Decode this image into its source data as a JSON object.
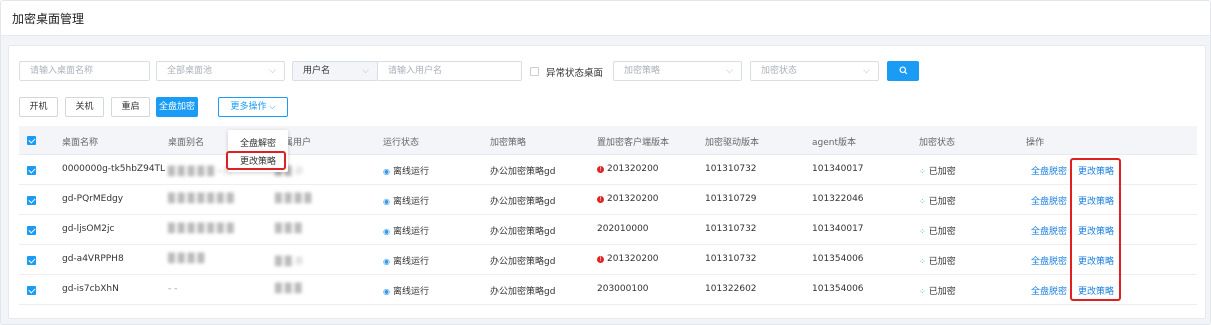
{
  "page": {
    "title": "加密桌面管理"
  },
  "filters": {
    "desktop_name_placeholder": "请输入桌面名称",
    "desktop_pool_placeholder": "全部桌面池",
    "user_type_selected": "用户名",
    "username_placeholder": "请输入用户名",
    "abnormal_label": "异常状态桌面",
    "policy_placeholder": "加密策略",
    "status_placeholder": "加密状态",
    "search_icon": "search-icon"
  },
  "toolbar": {
    "power_on": "开机",
    "power_off": "关机",
    "restart": "重启",
    "full_encrypt": "全盘加密",
    "more_actions": "更多操作"
  },
  "dropdown": {
    "full_decrypt": "全盘解密",
    "change_policy": "更改策略"
  },
  "table": {
    "headers": [
      "桌面名称",
      "桌面别名",
      "所属用户",
      "运行状态",
      "加密策略",
      "置加密客户端版本",
      "加密驱动版本",
      "agent版本",
      "加密状态",
      "操作"
    ],
    "rows": [
      {
        "name": "0000000g-tk5hbZ94TL",
        "alias": "█ █ █ █ █ ─力",
        "user": "█ █ 示",
        "run": "离线运行",
        "policy": "办公加密策略gd",
        "client": "201320200",
        "client_warn": true,
        "driver": "101310732",
        "agent": "101340017",
        "enc": "已加密",
        "op1": "全盘脱密",
        "op2": "更改策略"
      },
      {
        "name": "gd-PQrMEdgy",
        "alias": "█ █ █ █ █ █ █",
        "user": "█ █ █ █",
        "run": "离线运行",
        "policy": "办公加密策略gd",
        "client": "201320200",
        "client_warn": true,
        "driver": "101310729",
        "agent": "101322046",
        "enc": "已加密",
        "op1": "全盘脱密",
        "op2": "更改策略"
      },
      {
        "name": "gd-ljsOM2jc",
        "alias": "█ █ █ █ █ █ █",
        "user": "█ █ █",
        "run": "离线运行",
        "policy": "办公加密策略gd",
        "client": "202010000",
        "client_warn": false,
        "driver": "101310732",
        "agent": "101340017",
        "enc": "已加密",
        "op1": "全盘脱密",
        "op2": "更改策略"
      },
      {
        "name": "gd-a4VRPPH8",
        "alias": "█ █ █ █",
        "user": "█ █ 杀",
        "run": "离线运行",
        "policy": "办公加密策略gd",
        "client": "201320200",
        "client_warn": true,
        "driver": "101310732",
        "agent": "101354006",
        "enc": "已加密",
        "op1": "全盘脱密",
        "op2": "更改策略"
      },
      {
        "name": "gd-is7cbXhN",
        "alias": "- -",
        "user": "█ █ █",
        "run": "离线运行",
        "policy": "办公加密策略gd",
        "client": "203000100",
        "client_warn": false,
        "driver": "101322602",
        "agent": "101354006",
        "enc": "已加密",
        "op1": "全盘脱密",
        "op2": "更改策略"
      }
    ]
  },
  "colors": {
    "primary": "#1a9cf4",
    "highlight": "#e02020",
    "status_green": "#2bb673",
    "warn_red": "#e02424"
  }
}
